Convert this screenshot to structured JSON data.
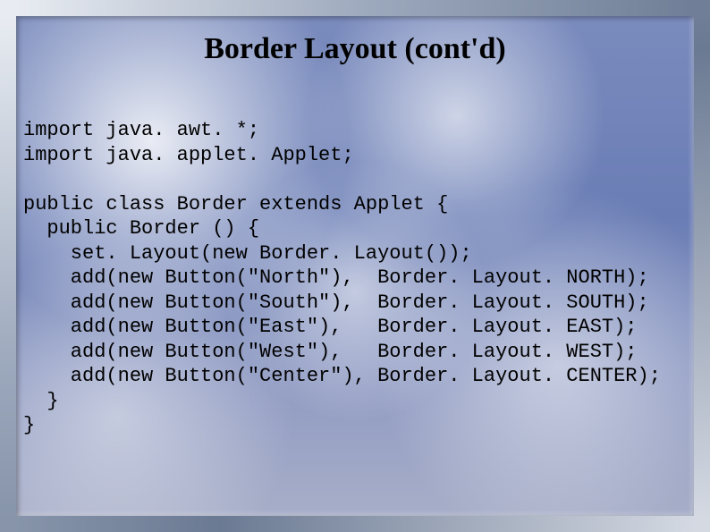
{
  "title": "Border Layout (cont'd)",
  "code": "import java. awt. *;\nimport java. applet. Applet;\n\npublic class Border extends Applet {\n  public Border () {\n    set. Layout(new Border. Layout());\n    add(new Button(\"North\"),  Border. Layout. NORTH);\n    add(new Button(\"South\"),  Border. Layout. SOUTH);\n    add(new Button(\"East\"),   Border. Layout. EAST);\n    add(new Button(\"West\"),   Border. Layout. WEST);\n    add(new Button(\"Center\"), Border. Layout. CENTER);\n  }\n}"
}
